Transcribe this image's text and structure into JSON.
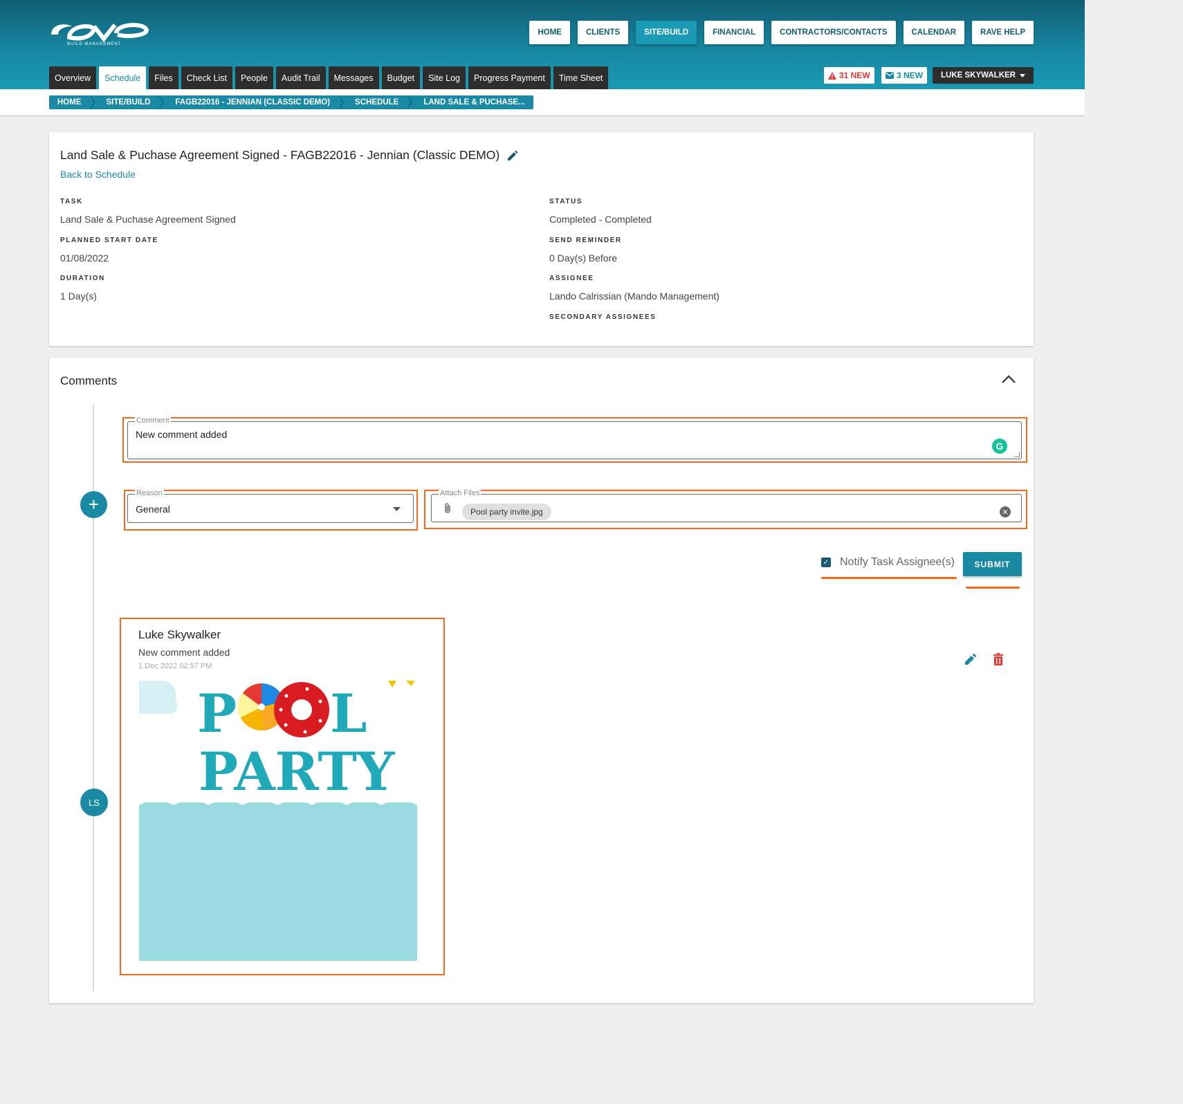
{
  "brand": {
    "logo_text": "rave",
    "logo_sub": "BUILD MANAGEMENT"
  },
  "topnav": [
    "HOME",
    "CLIENTS",
    "SITE/BUILD",
    "FINANCIAL",
    "CONTRACTORS/CONTACTS",
    "CALENDAR",
    "RAVE HELP"
  ],
  "tabs": [
    "Overview",
    "Schedule",
    "Files",
    "Check List",
    "People",
    "Audit Trail",
    "Messages",
    "Budget",
    "Site Log",
    "Progress Payment",
    "Time Sheet"
  ],
  "alerts_badge": "31 NEW",
  "mail_badge": "3 NEW",
  "user_menu": "LUKE SKYWALKER",
  "breadcrumb": [
    "HOME",
    "SITE/BUILD",
    "FAGB22016 - JENNIAN (CLASSIC DEMO)",
    "SCHEDULE",
    "LAND SALE & PUCHASE..."
  ],
  "task": {
    "title": "Land Sale & Puchase Agreement Signed - FAGB22016 - Jennian (Classic DEMO)",
    "back_link": "Back to Schedule",
    "labels": {
      "task": "TASK",
      "planned_start": "PLANNED START DATE",
      "duration": "DURATION",
      "status": "STATUS",
      "send_reminder": "SEND REMINDER",
      "assignee": "ASSIGNEE",
      "secondary": "SECONDARY ASSIGNEES"
    },
    "values": {
      "task": "Land Sale & Puchase Agreement Signed",
      "planned_start": "01/08/2022",
      "duration": "1 Day(s)",
      "status": "Completed - Completed",
      "send_reminder": "0 Day(s) Before",
      "assignee": "Lando Calrissian (Mando Management)"
    }
  },
  "comments": {
    "title": "Comments",
    "form": {
      "comment_legend": "Comment",
      "comment_value": "New comment added",
      "reason_legend": "Reason",
      "reason_value": "General",
      "attach_legend": "Attach Files",
      "attachment": "Pool party invite.jpg",
      "notify_label": "Notify Task Assignee(s)",
      "notify_checked": true,
      "submit": "SUBMIT"
    },
    "entry": {
      "initials": "LS",
      "author": "Luke Skywalker",
      "text": "New comment added",
      "date": "1 Dec 2022 02:57 PM",
      "image_text": [
        "POOL",
        "PARTY"
      ]
    }
  },
  "colors": {
    "teal": "#1a8aa4",
    "dark": "#2d2d2d",
    "highlight": "#f26a1b",
    "danger": "#e53935"
  }
}
